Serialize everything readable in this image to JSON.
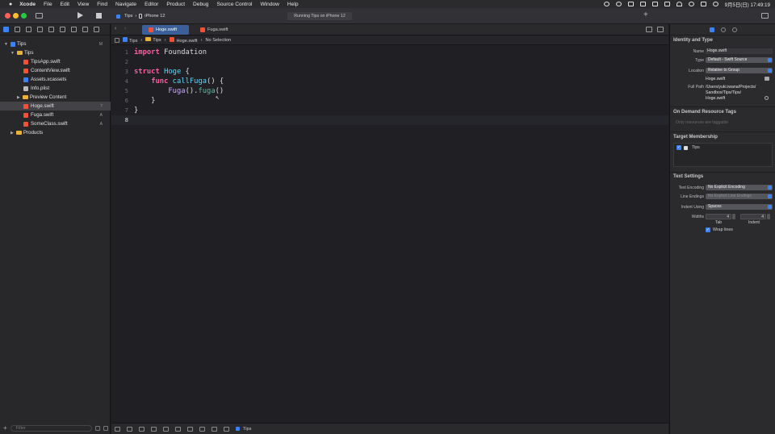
{
  "menubar": {
    "app": "Xcode",
    "items": [
      "File",
      "Edit",
      "View",
      "Find",
      "Navigate",
      "Editor",
      "Product",
      "Debug",
      "Source Control",
      "Window",
      "Help"
    ],
    "clock": "9月5日(日)  17:49:19"
  },
  "toolbar": {
    "scheme": "Tips",
    "destination": "iPhone 12",
    "status": "Running Tips on iPhone 12"
  },
  "tabs": [
    {
      "label": "Hoge.swift",
      "active": true
    },
    {
      "label": "Fuga.swift",
      "active": false
    }
  ],
  "jumpbar": [
    "Tips",
    "Tips",
    "Hoge.swift",
    "No Selection"
  ],
  "navigator": {
    "filter_placeholder": "Filter",
    "items": [
      {
        "label": "Tips",
        "kind": "project",
        "status": "M"
      },
      {
        "label": "Tips",
        "kind": "folder",
        "status": ""
      },
      {
        "label": "TipsApp.swift",
        "kind": "swift",
        "status": ""
      },
      {
        "label": "ContentView.swift",
        "kind": "swift",
        "status": ""
      },
      {
        "label": "Assets.xcassets",
        "kind": "assets",
        "status": ""
      },
      {
        "label": "Info.plist",
        "kind": "plist",
        "status": ""
      },
      {
        "label": "Preview Content",
        "kind": "folder",
        "status": ""
      },
      {
        "label": "Hoge.swift",
        "kind": "swift",
        "status": "?"
      },
      {
        "label": "Fuga.swift",
        "kind": "swift",
        "status": "A"
      },
      {
        "label": "SomeClass.swift",
        "kind": "swift",
        "status": "A"
      },
      {
        "label": "Products",
        "kind": "folder",
        "status": ""
      }
    ]
  },
  "editor": {
    "line_numbers": [
      "1",
      "2",
      "3",
      "4",
      "5",
      "6",
      "7",
      "8"
    ],
    "l1_kw": "import",
    "l1_rest": " Foundation",
    "l3_kw": "struct",
    "l3_name": " Hoge",
    "l3_rest": " {",
    "l4_indent": "    ",
    "l4_kw": "func",
    "l4_name": " callFuga",
    "l4_rest": "() {",
    "l5_indent": "        ",
    "l5_type": "Fuga",
    "l5_mid": "().",
    "l5_call": "fuga",
    "l5_rest": "()",
    "l6": "    }",
    "l7": "}"
  },
  "debugbar": {
    "target": "Tips"
  },
  "inspector": {
    "identity_title": "Identity and Type",
    "name_label": "Name",
    "name_value": "Hoge.swift",
    "type_label": "Type",
    "type_value": "Default - Swift Source",
    "location_label": "Location",
    "location_value": "Relative to Group",
    "location_file": "Hoge.swift",
    "fullpath_label": "Full Path",
    "fullpath_value": [
      "/Users/yuki.iwana/Projects/",
      "Sandbox/Tips/Tips/",
      "Hoge.swift"
    ],
    "odr_title": "On Demand Resource Tags",
    "odr_placeholder": "Only resources are taggable",
    "target_title": "Target Membership",
    "target_item": "Tips",
    "text_title": "Text Settings",
    "encoding_label": "Text Encoding",
    "encoding_value": "No Explicit Encoding",
    "endings_label": "Line Endings",
    "endings_value": "No Explicit Line Endings",
    "indent_label": "Indent Using",
    "indent_value": "Spaces",
    "widths_label": "Widths",
    "tab_value": "4",
    "indent_width_value": "4",
    "tab_caption": "Tab",
    "indent_caption": "Indent",
    "wrap_label": "Wrap lines"
  }
}
